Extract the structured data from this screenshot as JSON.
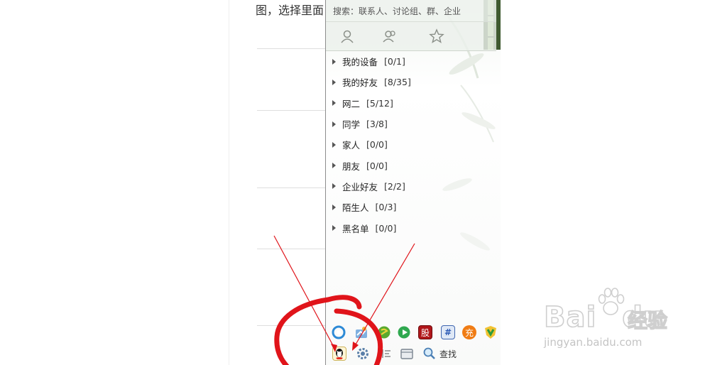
{
  "document": {
    "text_fragment": "图，选择里面"
  },
  "qq_panel": {
    "search_placeholder": "搜索：联系人、讨论组、群、企业",
    "tabs": [
      {
        "icon": "contact-icon"
      },
      {
        "icon": "group-icon"
      },
      {
        "icon": "star-icon"
      }
    ],
    "groups": [
      {
        "name": "我的设备",
        "count": "[0/1]"
      },
      {
        "name": "我的好友",
        "count": "[8/35]"
      },
      {
        "name": "网二",
        "count": "[5/12]"
      },
      {
        "name": "同学",
        "count": "[3/8]"
      },
      {
        "name": "家人",
        "count": "[0/0]"
      },
      {
        "name": "朋友",
        "count": "[0/0]"
      },
      {
        "name": "企业好友",
        "count": "[2/2]"
      },
      {
        "name": "陌生人",
        "count": "[0/3]"
      },
      {
        "name": "黑名单",
        "count": "[0/0]"
      }
    ],
    "app_bar": {
      "row1_icons": [
        "qzone-icon",
        "weather-icon",
        "game-icon",
        "video-icon",
        "stock-icon",
        "news-icon",
        "shopping-icon",
        "security-icon"
      ],
      "stock_label": "股",
      "news_label": "#",
      "shopping_label": "充",
      "row2_icons": [
        "qq-menu-icon",
        "settings-icon",
        "message-manager-icon",
        "file-icon",
        "find-icon"
      ],
      "find_label": "查找"
    }
  },
  "colors": {
    "annotation_red": "#e0141a",
    "panel_border": "#8d8d8d",
    "watermark_gray": "#cfcfcf"
  },
  "watermark": {
    "brand": "Bai",
    "brand_tail": "du",
    "jingyan": "经验",
    "url": "jingyan.baidu.com"
  }
}
